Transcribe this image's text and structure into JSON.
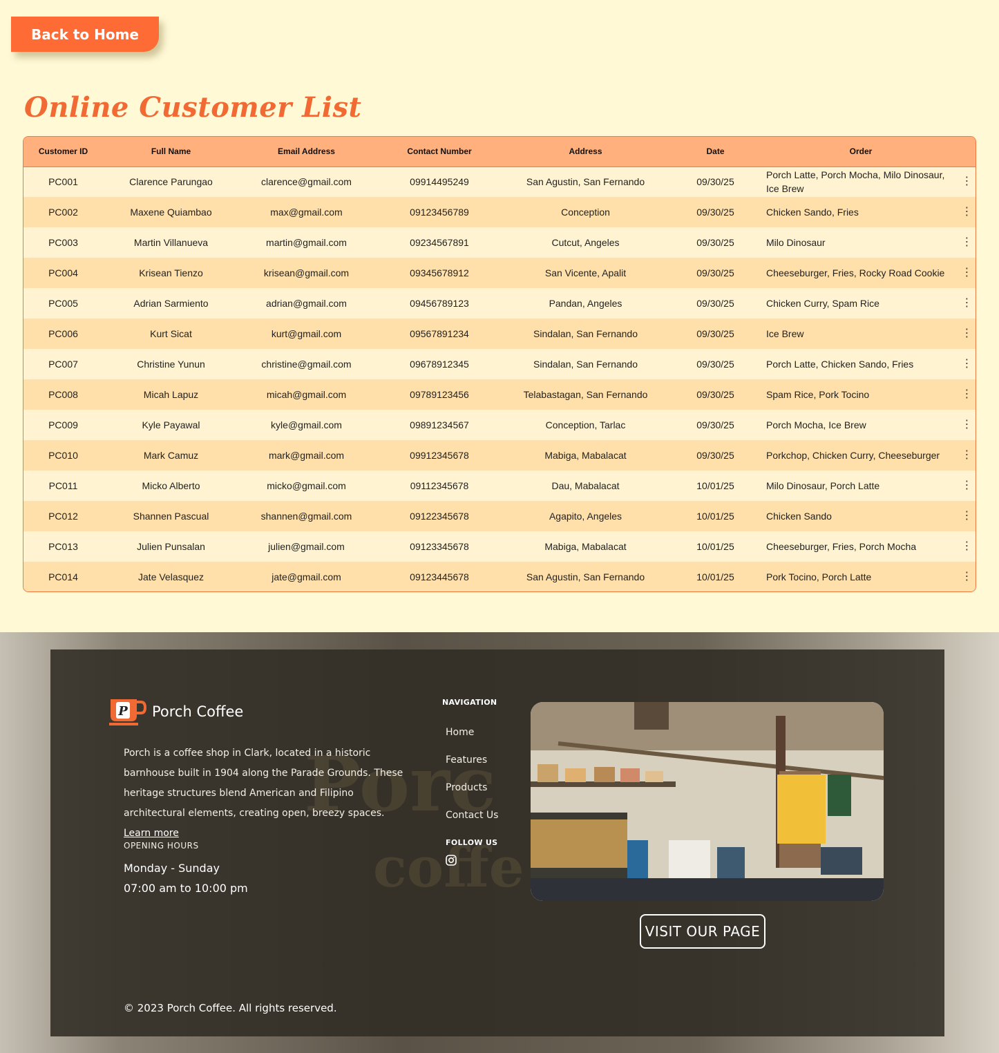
{
  "back_button": {
    "label": "Back to Home"
  },
  "page_title": "Online Customer List",
  "table": {
    "columns": [
      "Customer ID",
      "Full Name",
      "Email Address",
      "Contact Number",
      "Address",
      "Date",
      "Order"
    ],
    "rows": [
      [
        "PC001",
        "Clarence Parungao",
        "clarence@gmail.com",
        "09914495249",
        "San Agustin, San Fernando",
        "09/30/25",
        "Porch Latte, Porch Mocha, Milo Dinosaur, Ice Brew"
      ],
      [
        "PC002",
        "Maxene Quiambao",
        "max@gmail.com",
        "09123456789",
        "Conception",
        "09/30/25",
        "Chicken Sando, Fries"
      ],
      [
        "PC003",
        "Martin Villanueva",
        "martin@gmail.com",
        "09234567891",
        "Cutcut, Angeles",
        "09/30/25",
        "Milo Dinosaur"
      ],
      [
        "PC004",
        "Krisean Tienzo",
        "krisean@gmail.com",
        "09345678912",
        "San Vicente, Apalit",
        "09/30/25",
        "Cheeseburger, Fries, Rocky Road Cookie"
      ],
      [
        "PC005",
        "Adrian Sarmiento",
        "adrian@gmail.com",
        "09456789123",
        "Pandan, Angeles",
        "09/30/25",
        "Chicken Curry, Spam Rice"
      ],
      [
        "PC006",
        "Kurt Sicat",
        "kurt@gmail.com",
        "09567891234",
        "Sindalan, San Fernando",
        "09/30/25",
        "Ice Brew"
      ],
      [
        "PC007",
        "Christine Yunun",
        "christine@gmail.com",
        "09678912345",
        "Sindalan, San Fernando",
        "09/30/25",
        "Porch Latte, Chicken Sando, Fries"
      ],
      [
        "PC008",
        "Micah Lapuz",
        "micah@gmail.com",
        "09789123456",
        "Telabastagan, San Fernando",
        "09/30/25",
        "Spam Rice, Pork Tocino"
      ],
      [
        "PC009",
        "Kyle Payawal",
        "kyle@gmail.com",
        "09891234567",
        "Conception, Tarlac",
        "09/30/25",
        "Porch Mocha, Ice Brew"
      ],
      [
        "PC010",
        "Mark Camuz",
        "mark@gmail.com",
        "09912345678",
        "Mabiga, Mabalacat",
        "09/30/25",
        "Porkchop, Chicken Curry, Cheeseburger"
      ],
      [
        "PC011",
        "Micko Alberto",
        "micko@gmail.com",
        "09112345678",
        "Dau, Mabalacat",
        "10/01/25",
        "Milo Dinosaur, Porch Latte"
      ],
      [
        "PC012",
        "Shannen Pascual",
        "shannen@gmail.com",
        "09122345678",
        "Agapito, Angeles",
        "10/01/25",
        "Chicken Sando"
      ],
      [
        "PC013",
        "Julien Punsalan",
        "julien@gmail.com",
        "09123345678",
        "Mabiga, Mabalacat",
        "10/01/25",
        "Cheeseburger, Fries, Porch Mocha"
      ],
      [
        "PC014",
        "Jate Velasquez",
        "jate@gmail.com",
        "09123445678",
        "San Agustin, San Fernando",
        "10/01/25",
        "Pork Tocino, Porch Latte"
      ]
    ],
    "row_menu_icon": "kebab-menu-icon",
    "row_menu_glyph": "⋮"
  },
  "footer": {
    "brand_name": "Porch Coffee",
    "brand_logo_icon": "coffee-cup-logo-icon",
    "about_text": "Porch is a coffee shop in Clark, located in a historic barnhouse built in 1904 along the Parade Grounds. These heritage structures blend American and Filipino architectural elements, creating open, breezy spaces.",
    "learn_more": "Learn more",
    "opening_hours_title": "OPENING HOURS",
    "opening_days": "Monday - Sunday",
    "opening_time": "07:00 am to 10:00 pm",
    "navigation_title": "NAVIGATION",
    "nav_items": [
      "Home",
      "Features",
      "Products",
      "Contact Us"
    ],
    "follow_title": "FOLLOW US",
    "follow_icon": "instagram-icon",
    "visit_button": "VISIT OUR PAGE",
    "copyright": "© 2023 Porch Coffee. All rights reserved."
  },
  "colors": {
    "page_bg": "#fff9d6",
    "accent": "#ff6b35",
    "title": "#f26a33",
    "table_header": "#ffb07c",
    "row_odd": "#fff3d2",
    "row_even": "#ffe0ab",
    "footer_panel": "#302c24"
  }
}
